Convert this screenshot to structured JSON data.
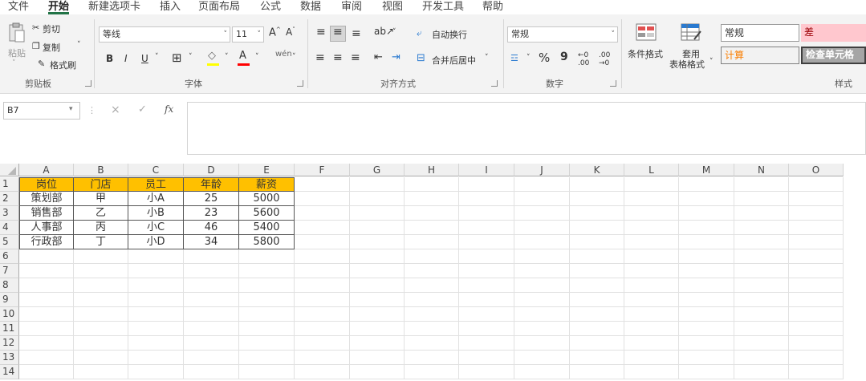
{
  "menu": {
    "tabs": [
      "文件",
      "开始",
      "新建选项卡",
      "插入",
      "页面布局",
      "公式",
      "数据",
      "审阅",
      "视图",
      "开发工具",
      "帮助"
    ]
  },
  "clipboard": {
    "paste_label": "粘贴",
    "cut_label": "剪切",
    "copy_label": "复制",
    "format_painter_label": "格式刷",
    "group_label": "剪贴板"
  },
  "font": {
    "font_name": "等线",
    "font_size": "11",
    "grow_label": "A^",
    "shrink_label": "A˅",
    "bold": "B",
    "italic": "I",
    "underline": "U",
    "group_label": "字体"
  },
  "alignment": {
    "wrap_label": "自动换行",
    "merge_label": "合并后居中",
    "group_label": "对齐方式"
  },
  "number": {
    "format": "常规",
    "percent": "%",
    "comma": "9",
    "group_label": "数字"
  },
  "styles": {
    "cond_format_label": "条件格式",
    "table_format_line1": "套用",
    "table_format_line2": "表格格式",
    "normal_label": "常规",
    "bad_label": "差",
    "calc_label": "计算",
    "check_label": "检查单元格",
    "group_label": "样式"
  },
  "formula_bar": {
    "name_box": "B7",
    "fx": "fx",
    "cancel": "×",
    "enter": "✓",
    "content": ""
  },
  "columns": [
    "A",
    "B",
    "C",
    "D",
    "E",
    "F",
    "G",
    "H",
    "I",
    "J",
    "K",
    "L",
    "M",
    "N",
    "O"
  ],
  "rows": [
    "1",
    "2",
    "3",
    "4",
    "5",
    "6",
    "7",
    "8",
    "9",
    "10",
    "11",
    "12",
    "13",
    "14"
  ],
  "table": {
    "headers": [
      "岗位",
      "门店",
      "员工",
      "年龄",
      "薪资"
    ],
    "data": [
      [
        "策划部",
        "甲",
        "小A",
        "25",
        "5000"
      ],
      [
        "销售部",
        "乙",
        "小B",
        "23",
        "5600"
      ],
      [
        "人事部",
        "丙",
        "小C",
        "46",
        "5400"
      ],
      [
        "行政部",
        "丁",
        "小D",
        "34",
        "5800"
      ]
    ]
  },
  "colors": {
    "header_fill": "#ffc000",
    "accent": "#217346",
    "bad_fill": "#ffc7ce",
    "bad_text": "#9c0006",
    "calc_text": "#fa7d00"
  }
}
